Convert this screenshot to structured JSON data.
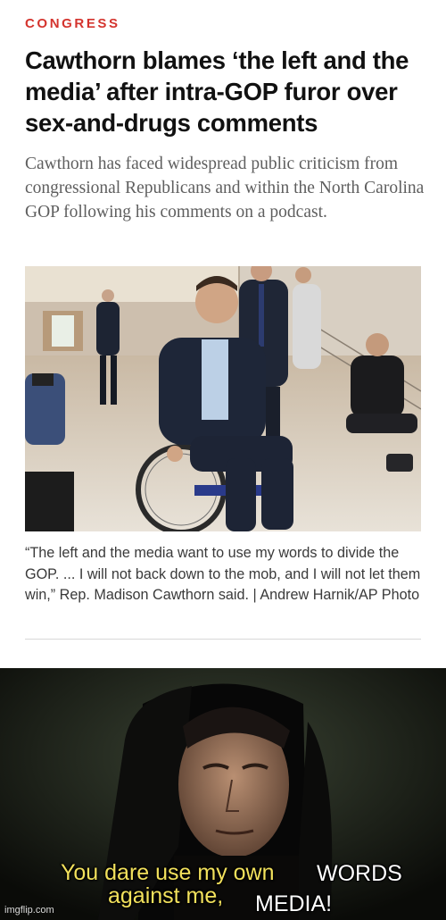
{
  "article": {
    "section": "CONGRESS",
    "headline": "Cawthorn blames ‘the left and the media’ after intra-GOP furor over sex-and-drugs comments",
    "dek": "Cawthorn has faced widespread public criticism from congressional Republicans and within the North Carolina GOP following his comments on a podcast.",
    "photo_caption": "“The left and the media want to use my words to divide the GOP. ... I will not back down to the mob, and I will not let them win,” Rep. Madison Cawthorn said. | Andrew Harnik/AP Photo"
  },
  "meme": {
    "caption_line1": "You dare use my own",
    "caption_line2": "against me,",
    "overlay_word1": "WORDS",
    "overlay_word2": "MEDIA!",
    "watermark": "imgflip.com"
  },
  "colors": {
    "section_red": "#d4342e",
    "headline": "#111111",
    "dek_gray": "#5e5e5e",
    "caption_yellow": "#f2e15c"
  }
}
